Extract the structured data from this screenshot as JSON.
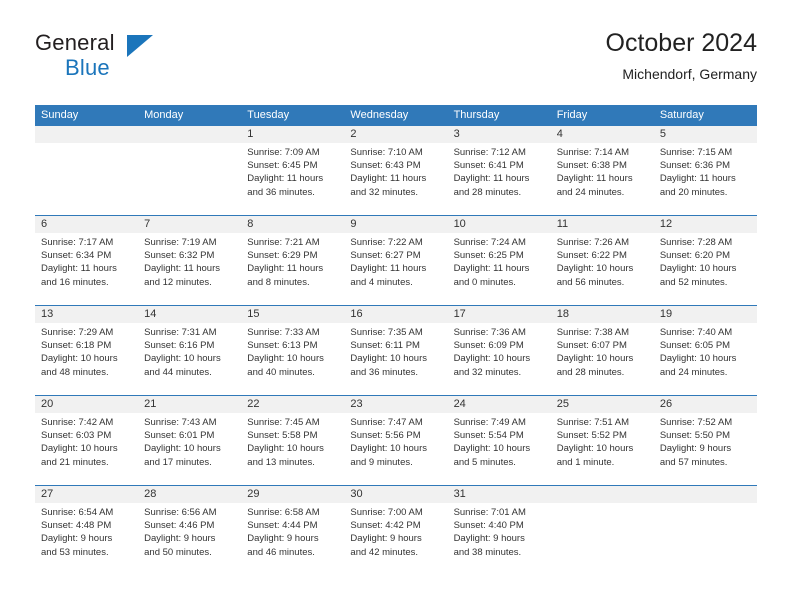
{
  "brand": {
    "name_part1": "General",
    "name_part2": "Blue",
    "accent_color": "#1b75bb"
  },
  "header": {
    "title": "October 2024",
    "subtitle": "Michendorf, Germany",
    "header_bg_color": "#3079b9",
    "day_band_color": "#f1f1f1"
  },
  "weekdays": [
    "Sunday",
    "Monday",
    "Tuesday",
    "Wednesday",
    "Thursday",
    "Friday",
    "Saturday"
  ],
  "weeks": [
    [
      {
        "day": "",
        "empty": true
      },
      {
        "day": "",
        "empty": true
      },
      {
        "day": "1",
        "sunrise": "Sunrise: 7:09 AM",
        "sunset": "Sunset: 6:45 PM",
        "daylight1": "Daylight: 11 hours",
        "daylight2": "and 36 minutes."
      },
      {
        "day": "2",
        "sunrise": "Sunrise: 7:10 AM",
        "sunset": "Sunset: 6:43 PM",
        "daylight1": "Daylight: 11 hours",
        "daylight2": "and 32 minutes."
      },
      {
        "day": "3",
        "sunrise": "Sunrise: 7:12 AM",
        "sunset": "Sunset: 6:41 PM",
        "daylight1": "Daylight: 11 hours",
        "daylight2": "and 28 minutes."
      },
      {
        "day": "4",
        "sunrise": "Sunrise: 7:14 AM",
        "sunset": "Sunset: 6:38 PM",
        "daylight1": "Daylight: 11 hours",
        "daylight2": "and 24 minutes."
      },
      {
        "day": "5",
        "sunrise": "Sunrise: 7:15 AM",
        "sunset": "Sunset: 6:36 PM",
        "daylight1": "Daylight: 11 hours",
        "daylight2": "and 20 minutes."
      }
    ],
    [
      {
        "day": "6",
        "sunrise": "Sunrise: 7:17 AM",
        "sunset": "Sunset: 6:34 PM",
        "daylight1": "Daylight: 11 hours",
        "daylight2": "and 16 minutes."
      },
      {
        "day": "7",
        "sunrise": "Sunrise: 7:19 AM",
        "sunset": "Sunset: 6:32 PM",
        "daylight1": "Daylight: 11 hours",
        "daylight2": "and 12 minutes."
      },
      {
        "day": "8",
        "sunrise": "Sunrise: 7:21 AM",
        "sunset": "Sunset: 6:29 PM",
        "daylight1": "Daylight: 11 hours",
        "daylight2": "and 8 minutes."
      },
      {
        "day": "9",
        "sunrise": "Sunrise: 7:22 AM",
        "sunset": "Sunset: 6:27 PM",
        "daylight1": "Daylight: 11 hours",
        "daylight2": "and 4 minutes."
      },
      {
        "day": "10",
        "sunrise": "Sunrise: 7:24 AM",
        "sunset": "Sunset: 6:25 PM",
        "daylight1": "Daylight: 11 hours",
        "daylight2": "and 0 minutes."
      },
      {
        "day": "11",
        "sunrise": "Sunrise: 7:26 AM",
        "sunset": "Sunset: 6:22 PM",
        "daylight1": "Daylight: 10 hours",
        "daylight2": "and 56 minutes."
      },
      {
        "day": "12",
        "sunrise": "Sunrise: 7:28 AM",
        "sunset": "Sunset: 6:20 PM",
        "daylight1": "Daylight: 10 hours",
        "daylight2": "and 52 minutes."
      }
    ],
    [
      {
        "day": "13",
        "sunrise": "Sunrise: 7:29 AM",
        "sunset": "Sunset: 6:18 PM",
        "daylight1": "Daylight: 10 hours",
        "daylight2": "and 48 minutes."
      },
      {
        "day": "14",
        "sunrise": "Sunrise: 7:31 AM",
        "sunset": "Sunset: 6:16 PM",
        "daylight1": "Daylight: 10 hours",
        "daylight2": "and 44 minutes."
      },
      {
        "day": "15",
        "sunrise": "Sunrise: 7:33 AM",
        "sunset": "Sunset: 6:13 PM",
        "daylight1": "Daylight: 10 hours",
        "daylight2": "and 40 minutes."
      },
      {
        "day": "16",
        "sunrise": "Sunrise: 7:35 AM",
        "sunset": "Sunset: 6:11 PM",
        "daylight1": "Daylight: 10 hours",
        "daylight2": "and 36 minutes."
      },
      {
        "day": "17",
        "sunrise": "Sunrise: 7:36 AM",
        "sunset": "Sunset: 6:09 PM",
        "daylight1": "Daylight: 10 hours",
        "daylight2": "and 32 minutes."
      },
      {
        "day": "18",
        "sunrise": "Sunrise: 7:38 AM",
        "sunset": "Sunset: 6:07 PM",
        "daylight1": "Daylight: 10 hours",
        "daylight2": "and 28 minutes."
      },
      {
        "day": "19",
        "sunrise": "Sunrise: 7:40 AM",
        "sunset": "Sunset: 6:05 PM",
        "daylight1": "Daylight: 10 hours",
        "daylight2": "and 24 minutes."
      }
    ],
    [
      {
        "day": "20",
        "sunrise": "Sunrise: 7:42 AM",
        "sunset": "Sunset: 6:03 PM",
        "daylight1": "Daylight: 10 hours",
        "daylight2": "and 21 minutes."
      },
      {
        "day": "21",
        "sunrise": "Sunrise: 7:43 AM",
        "sunset": "Sunset: 6:01 PM",
        "daylight1": "Daylight: 10 hours",
        "daylight2": "and 17 minutes."
      },
      {
        "day": "22",
        "sunrise": "Sunrise: 7:45 AM",
        "sunset": "Sunset: 5:58 PM",
        "daylight1": "Daylight: 10 hours",
        "daylight2": "and 13 minutes."
      },
      {
        "day": "23",
        "sunrise": "Sunrise: 7:47 AM",
        "sunset": "Sunset: 5:56 PM",
        "daylight1": "Daylight: 10 hours",
        "daylight2": "and 9 minutes."
      },
      {
        "day": "24",
        "sunrise": "Sunrise: 7:49 AM",
        "sunset": "Sunset: 5:54 PM",
        "daylight1": "Daylight: 10 hours",
        "daylight2": "and 5 minutes."
      },
      {
        "day": "25",
        "sunrise": "Sunrise: 7:51 AM",
        "sunset": "Sunset: 5:52 PM",
        "daylight1": "Daylight: 10 hours",
        "daylight2": "and 1 minute."
      },
      {
        "day": "26",
        "sunrise": "Sunrise: 7:52 AM",
        "sunset": "Sunset: 5:50 PM",
        "daylight1": "Daylight: 9 hours",
        "daylight2": "and 57 minutes."
      }
    ],
    [
      {
        "day": "27",
        "sunrise": "Sunrise: 6:54 AM",
        "sunset": "Sunset: 4:48 PM",
        "daylight1": "Daylight: 9 hours",
        "daylight2": "and 53 minutes."
      },
      {
        "day": "28",
        "sunrise": "Sunrise: 6:56 AM",
        "sunset": "Sunset: 4:46 PM",
        "daylight1": "Daylight: 9 hours",
        "daylight2": "and 50 minutes."
      },
      {
        "day": "29",
        "sunrise": "Sunrise: 6:58 AM",
        "sunset": "Sunset: 4:44 PM",
        "daylight1": "Daylight: 9 hours",
        "daylight2": "and 46 minutes."
      },
      {
        "day": "30",
        "sunrise": "Sunrise: 7:00 AM",
        "sunset": "Sunset: 4:42 PM",
        "daylight1": "Daylight: 9 hours",
        "daylight2": "and 42 minutes."
      },
      {
        "day": "31",
        "sunrise": "Sunrise: 7:01 AM",
        "sunset": "Sunset: 4:40 PM",
        "daylight1": "Daylight: 9 hours",
        "daylight2": "and 38 minutes."
      },
      {
        "day": "",
        "empty": true
      },
      {
        "day": "",
        "empty": true
      }
    ]
  ]
}
